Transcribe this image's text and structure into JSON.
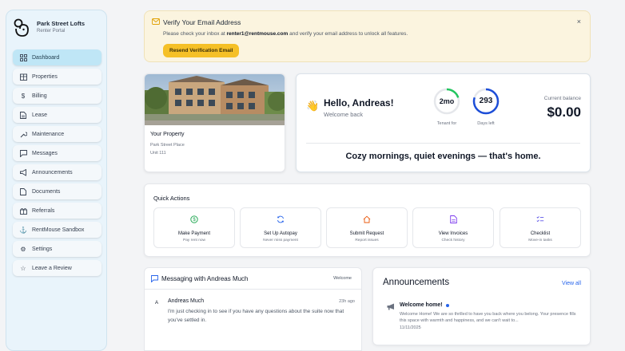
{
  "brand": {
    "name": "Park Street Lofts",
    "subtitle": "Renter Portal"
  },
  "sidebar": {
    "items": [
      {
        "label": "Dashboard",
        "icon": "grid-icon",
        "active": true
      },
      {
        "label": "Properties",
        "icon": "building-icon"
      },
      {
        "label": "Billing",
        "icon": "dollar-icon"
      },
      {
        "label": "Lease",
        "icon": "document-icon"
      },
      {
        "label": "Maintenance",
        "icon": "wrench-icon"
      },
      {
        "label": "Messages",
        "icon": "chat-icon"
      },
      {
        "label": "Announcements",
        "icon": "megaphone-icon"
      },
      {
        "label": "Documents",
        "icon": "file-icon"
      },
      {
        "label": "Referrals",
        "icon": "gift-icon"
      },
      {
        "label": "RentMouse Sandbox",
        "icon": "anchor-icon"
      },
      {
        "label": "Settings",
        "icon": "gear-icon"
      },
      {
        "label": "Leave a Review",
        "icon": "star-icon"
      }
    ]
  },
  "banner": {
    "title": "Verify Your Email Address",
    "text_before": "Please check your inbox at ",
    "email": "renter1@rentmouse.com",
    "text_after": " and verify your email address to unlock all features.",
    "button": "Resend Verification Email",
    "close": "×",
    "color": "#f5c027"
  },
  "property": {
    "title": "Your Property",
    "line1": "Park Street Place",
    "line2": "Unit 111"
  },
  "welcome": {
    "greeting": "Hello, Andreas!",
    "sub": "Welcome back",
    "tenant_for": {
      "value": "2mo",
      "label": "Tenant for",
      "fraction": 0.2,
      "color": "#22c55e"
    },
    "days_left": {
      "value": "293",
      "label": "Days left",
      "fraction": 0.8,
      "color": "#1d4ed8"
    },
    "balance_label": "Current balance",
    "balance": "$0.00",
    "tagline": "Cozy mornings, quiet evenings — that's home."
  },
  "quick_actions": {
    "title": "Quick Actions",
    "items": [
      {
        "label": "Make Payment",
        "sub": "Pay rent now",
        "icon": "dollar-circle-icon",
        "color": "#16a34a"
      },
      {
        "label": "Set Up Autopay",
        "sub": "Never miss payment",
        "icon": "refresh-icon",
        "color": "#2563eb"
      },
      {
        "label": "Submit Request",
        "sub": "Report issues",
        "icon": "home-icon",
        "color": "#ea580c"
      },
      {
        "label": "View Invoices",
        "sub": "Check history",
        "icon": "invoice-icon",
        "color": "#7c3aed"
      },
      {
        "label": "Checklist",
        "sub": "Move-in tasks",
        "icon": "checklist-icon",
        "color": "#4f46e5"
      }
    ]
  },
  "messaging": {
    "title": "Messaging with Andreas Much",
    "tag": "Welcome",
    "avatar": "A",
    "sender": "Andreas Much",
    "time": "23h ago",
    "body": "I'm just checking in to see if you have any questions about the suite now that you've settled in."
  },
  "announcements": {
    "title": "Announcements",
    "view_all": "View all",
    "item_title": "Welcome home!",
    "item_body": "Welcome Home! We are so thrilled to have you back where you belong. Your presence fills this space with warmth and happiness, and we can't wait to...",
    "item_date": "11/11/2025"
  }
}
